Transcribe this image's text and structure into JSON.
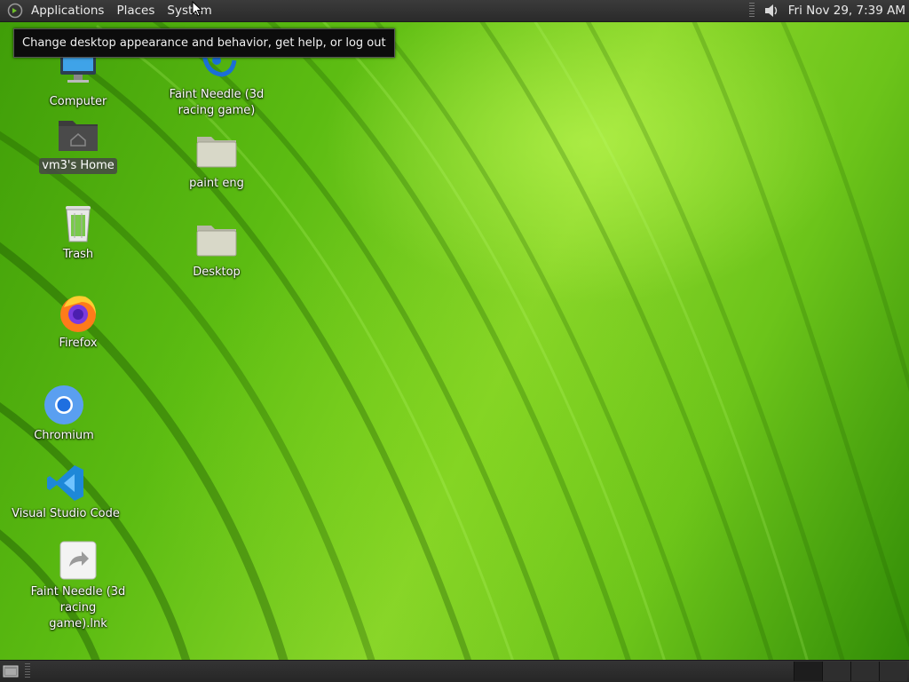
{
  "top_panel": {
    "menus": [
      {
        "label": "Applications"
      },
      {
        "label": "Places"
      },
      {
        "label": "System"
      }
    ],
    "clock": "Fri Nov 29,  7:39 AM"
  },
  "tooltip": "Change desktop appearance and behavior, get help, or log out",
  "desktop_icons": [
    {
      "label": "Computer",
      "icon": "computer-icon"
    },
    {
      "label": "vm3's Home",
      "icon": "home-folder-icon",
      "selected": true
    },
    {
      "label": "Trash",
      "icon": "trash-icon"
    },
    {
      "label": "Firefox",
      "icon": "firefox-icon"
    },
    {
      "label": "Chromium",
      "icon": "chromium-icon"
    },
    {
      "label": "Visual Studio Code",
      "icon": "vscode-icon"
    },
    {
      "label": "Faint Needle (3d racing game).lnk",
      "icon": "shortcut-file-icon"
    },
    {
      "label": "Faint Needle (3d racing game)",
      "icon": "faint-needle-icon"
    },
    {
      "label": "paint eng",
      "icon": "folder-icon"
    },
    {
      "label": "Desktop",
      "icon": "folder-icon"
    }
  ],
  "bottom_panel": {
    "workspaces": 4,
    "active_workspace": 1
  },
  "colors": {
    "panel": "#2e2e2e",
    "wallpaper_green": "#5cbc12",
    "tooltip_bg": "#0c0c0c"
  }
}
